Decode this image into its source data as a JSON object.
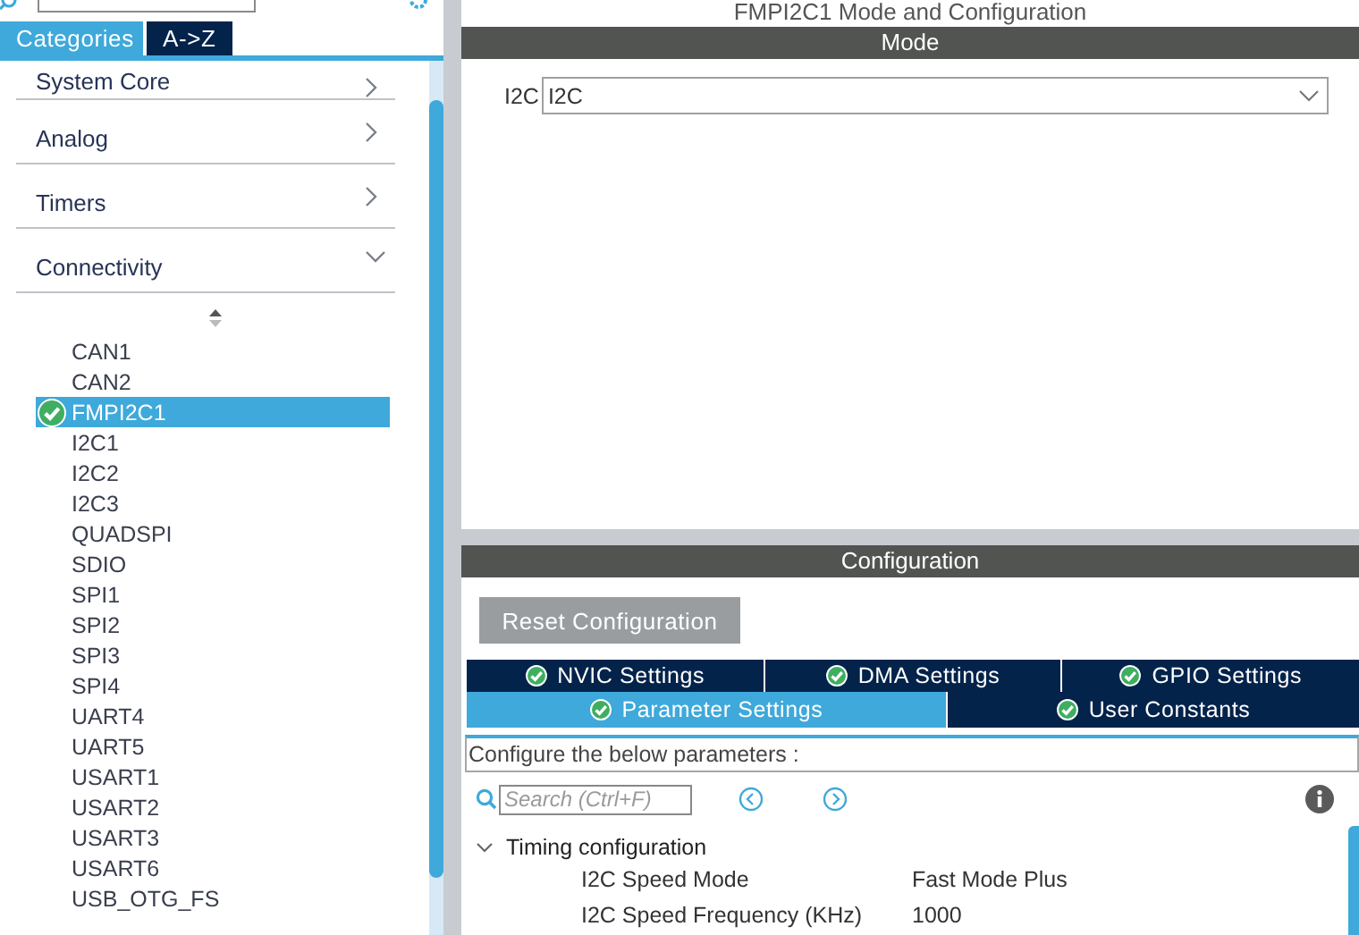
{
  "sidebar": {
    "tabs": [
      {
        "label": "Categories",
        "selected": true
      },
      {
        "label": "A->Z",
        "selected": false
      }
    ],
    "categories": [
      {
        "label": "System Core",
        "expanded": false
      },
      {
        "label": "Analog",
        "expanded": false
      },
      {
        "label": "Timers",
        "expanded": false
      },
      {
        "label": "Connectivity",
        "expanded": true
      }
    ],
    "peripherals": [
      {
        "label": "CAN1",
        "selected": false,
        "configured": false
      },
      {
        "label": "CAN2",
        "selected": false,
        "configured": false
      },
      {
        "label": "FMPI2C1",
        "selected": true,
        "configured": true
      },
      {
        "label": "I2C1",
        "selected": false,
        "configured": false
      },
      {
        "label": "I2C2",
        "selected": false,
        "configured": false
      },
      {
        "label": "I2C3",
        "selected": false,
        "configured": false
      },
      {
        "label": "QUADSPI",
        "selected": false,
        "configured": false
      },
      {
        "label": "SDIO",
        "selected": false,
        "configured": false
      },
      {
        "label": "SPI1",
        "selected": false,
        "configured": false
      },
      {
        "label": "SPI2",
        "selected": false,
        "configured": false
      },
      {
        "label": "SPI3",
        "selected": false,
        "configured": false
      },
      {
        "label": "SPI4",
        "selected": false,
        "configured": false
      },
      {
        "label": "UART4",
        "selected": false,
        "configured": false
      },
      {
        "label": "UART5",
        "selected": false,
        "configured": false
      },
      {
        "label": "USART1",
        "selected": false,
        "configured": false
      },
      {
        "label": "USART2",
        "selected": false,
        "configured": false
      },
      {
        "label": "USART3",
        "selected": false,
        "configured": false
      },
      {
        "label": "USART6",
        "selected": false,
        "configured": false
      },
      {
        "label": "USB_OTG_FS",
        "selected": false,
        "configured": false
      }
    ]
  },
  "main": {
    "title": "FMPI2C1 Mode and Configuration",
    "mode": {
      "header": "Mode",
      "fields": [
        {
          "label": "I2C",
          "value": "I2C"
        }
      ]
    },
    "configuration": {
      "header": "Configuration",
      "reset_button": "Reset Configuration",
      "tab_rows": [
        [
          {
            "label": "NVIC Settings",
            "selected": false,
            "valid": true
          },
          {
            "label": "DMA Settings",
            "selected": false,
            "valid": true
          },
          {
            "label": "GPIO Settings",
            "selected": false,
            "valid": true
          }
        ],
        [
          {
            "label": "Parameter Settings",
            "selected": true,
            "valid": true
          },
          {
            "label": "User Constants",
            "selected": false,
            "valid": true
          }
        ]
      ],
      "description": "Configure the below parameters :",
      "search": {
        "placeholder": "Search (Ctrl+F)"
      },
      "groups": [
        {
          "label": "Timing configuration",
          "expanded": true,
          "params": [
            {
              "name": "I2C Speed Mode",
              "value": "Fast Mode Plus"
            },
            {
              "name": "I2C Speed Frequency (KHz)",
              "value": "1000"
            }
          ]
        }
      ]
    }
  }
}
